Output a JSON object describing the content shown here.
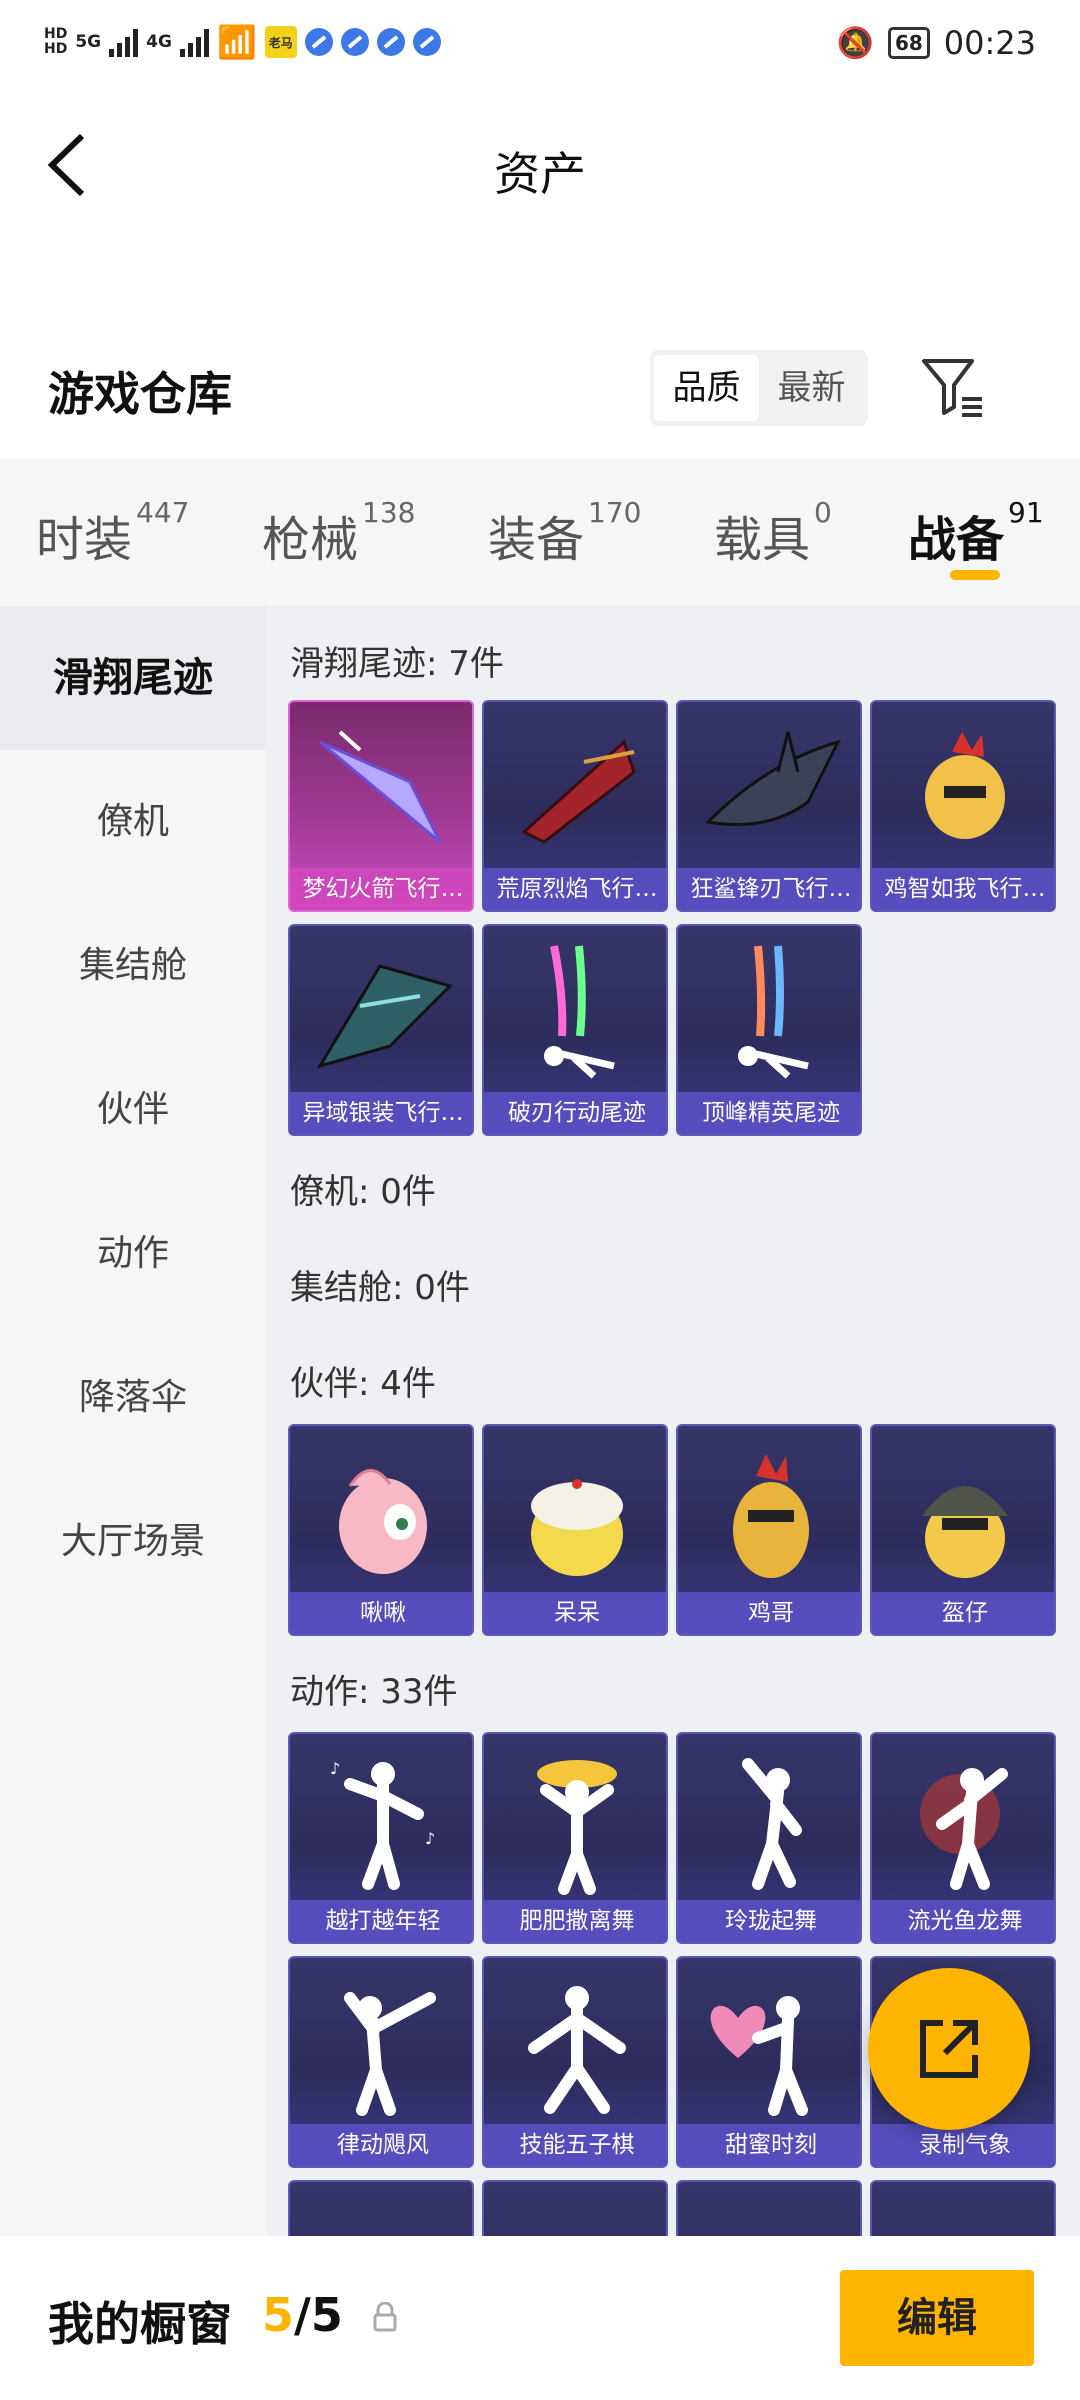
{
  "status_bar": {
    "hd_top": "HD",
    "hd_bottom": "HD",
    "net1": "5G",
    "net2": "4G",
    "app_badge": "老马",
    "battery": "68",
    "time": "00:23"
  },
  "header": {
    "title": "资产"
  },
  "warehouse": {
    "title": "游戏仓库",
    "sort_options": [
      "品质",
      "最新"
    ],
    "sort_selected": "品质"
  },
  "tabs": [
    {
      "label": "时装",
      "count": "447"
    },
    {
      "label": "枪械",
      "count": "138"
    },
    {
      "label": "装备",
      "count": "170"
    },
    {
      "label": "载具",
      "count": "0"
    },
    {
      "label": "战备",
      "count": "91",
      "active": true
    }
  ],
  "sidenav": [
    {
      "label": "滑翔尾迹",
      "active": true
    },
    {
      "label": "僚机"
    },
    {
      "label": "集结舱"
    },
    {
      "label": "伙伴"
    },
    {
      "label": "动作"
    },
    {
      "label": "降落伞"
    },
    {
      "label": "大厅场景"
    }
  ],
  "groups": {
    "glide": {
      "title": "滑翔尾迹: 7件",
      "items": [
        "梦幻火箭飞行…",
        "荒原烈焰飞行…",
        "狂鲨锋刃飞行…",
        "鸡智如我飞行…",
        "异域银装飞行…",
        "破刃行动尾迹",
        "顶峰精英尾迹"
      ]
    },
    "wingman": {
      "title": "僚机: 0件"
    },
    "capsule": {
      "title": "集结舱: 0件"
    },
    "partner": {
      "title": "伙伴: 4件",
      "items": [
        "啾啾",
        "呆呆",
        "鸡哥",
        "盔仔"
      ]
    },
    "emote": {
      "title": "动作: 33件",
      "items": [
        "越打越年轻",
        "肥肥撒离舞",
        "玲珑起舞",
        "流光鱼龙舞",
        "律动飓风",
        "技能五子棋",
        "甜蜜时刻",
        "录制气象"
      ]
    }
  },
  "bottom_bar": {
    "label": "我的橱窗",
    "current": "5",
    "separator": "/",
    "total": "5",
    "edit_label": "编辑"
  },
  "colors": {
    "accent": "#ffb400",
    "card_bg": "#2d2c5c",
    "card_label": "#6054d2",
    "card_highlight": "#c94dbf"
  }
}
